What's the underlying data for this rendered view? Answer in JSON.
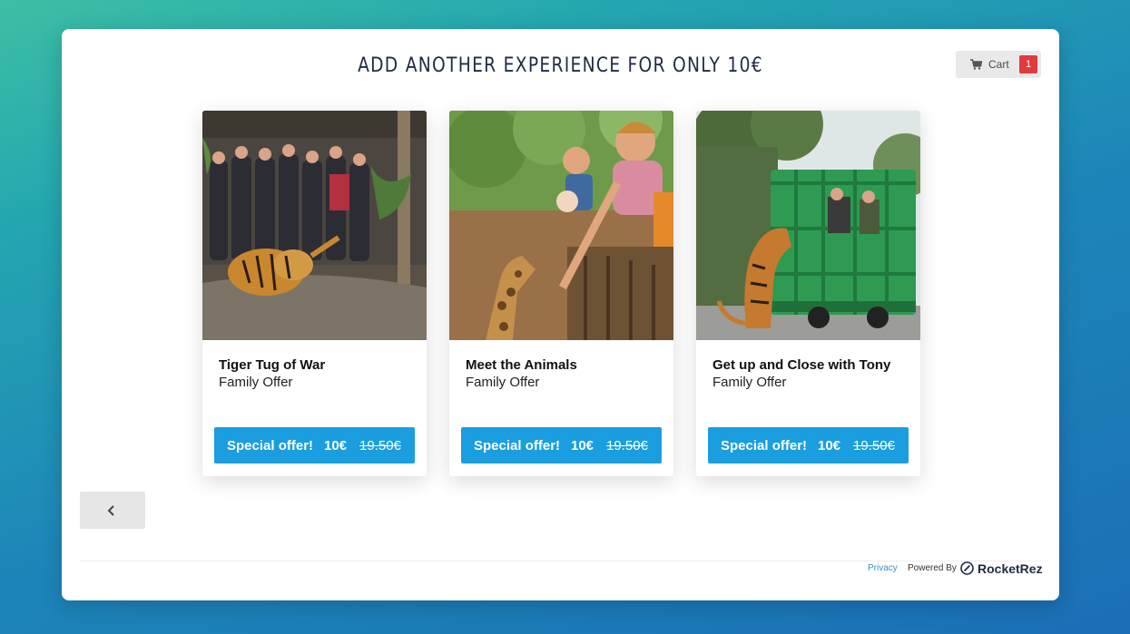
{
  "header": {
    "title": "ADD ANOTHER EXPERIENCE FOR ONLY 10€"
  },
  "cart": {
    "icon": "cart-icon",
    "label": "Cart",
    "count": "1"
  },
  "cards": [
    {
      "title": "Tiger Tug of War",
      "subtitle": "Family Offer",
      "offer_label": "Special offer!",
      "price": "10€",
      "old_price": "19.50€"
    },
    {
      "title": "Meet the Animals",
      "subtitle": "Family Offer",
      "offer_label": "Special offer!",
      "price": "10€",
      "old_price": "19.50€"
    },
    {
      "title": "Get up and Close with Tony",
      "subtitle": "Family Offer",
      "offer_label": "Special offer!",
      "price": "10€",
      "old_price": "19.50€"
    }
  ],
  "navigation": {
    "prev_icon": "chevron-left-icon"
  },
  "footer": {
    "privacy": "Privacy",
    "powered_by": "Powered By",
    "brand": "RocketRez"
  },
  "colors": {
    "accent": "#1a9ee0",
    "cart_badge": "#e23a3a",
    "title": "#1f2b45",
    "background_top": "#3dbfa4",
    "background_bottom": "#1b6fb5"
  }
}
